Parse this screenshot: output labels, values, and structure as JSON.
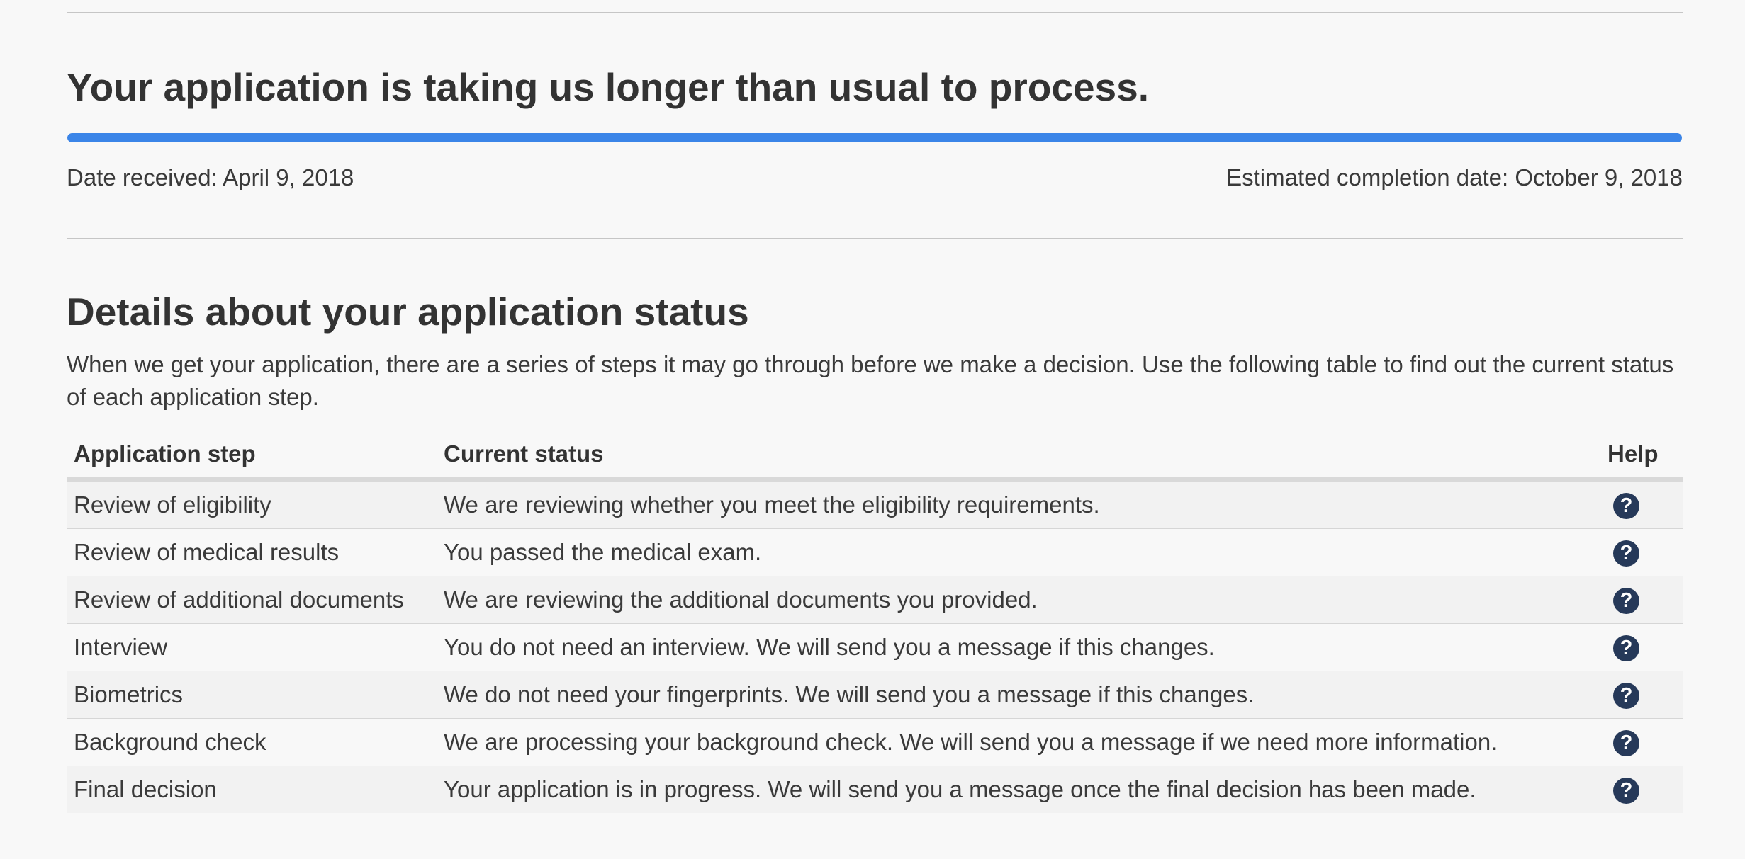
{
  "header": {
    "title": "Your application is taking us longer than usual to process.",
    "progress": {
      "percent": 100,
      "color": "#3b85e8"
    },
    "date_received": "Date received: April 9, 2018",
    "estimated_completion": "Estimated completion date: October 9, 2018"
  },
  "details": {
    "title": "Details about your application status",
    "intro": "When we get your application, there are a series of steps it may go through before we make a decision. Use the following table to find out the current status of each application step.",
    "table": {
      "columns": [
        "Application step",
        "Current status",
        "Help"
      ],
      "rows": [
        {
          "step": "Review of eligibility",
          "status": "We are reviewing whether you meet the eligibility requirements.",
          "help_icon": "question-circle-icon"
        },
        {
          "step": "Review of medical results",
          "status": "You passed the medical exam.",
          "help_icon": "question-circle-icon"
        },
        {
          "step": "Review of additional documents",
          "status": "We are reviewing the additional documents you provided.",
          "help_icon": "question-circle-icon"
        },
        {
          "step": "Interview",
          "status": "You do not need an interview. We will send you a message if this changes.",
          "help_icon": "question-circle-icon"
        },
        {
          "step": "Biometrics",
          "status": "We do not need your fingerprints. We will send you a message if this changes.",
          "help_icon": "question-circle-icon"
        },
        {
          "step": "Background check",
          "status": "We are processing your background check. We will send you a message if we need more information.",
          "help_icon": "question-circle-icon"
        },
        {
          "step": "Final decision",
          "status": "Your application is in progress. We will send you a message once the final decision has been made.",
          "help_icon": "question-circle-icon"
        }
      ]
    }
  },
  "colors": {
    "text": "#333333",
    "progress": "#3b85e8",
    "help_icon_bg": "#263959"
  }
}
